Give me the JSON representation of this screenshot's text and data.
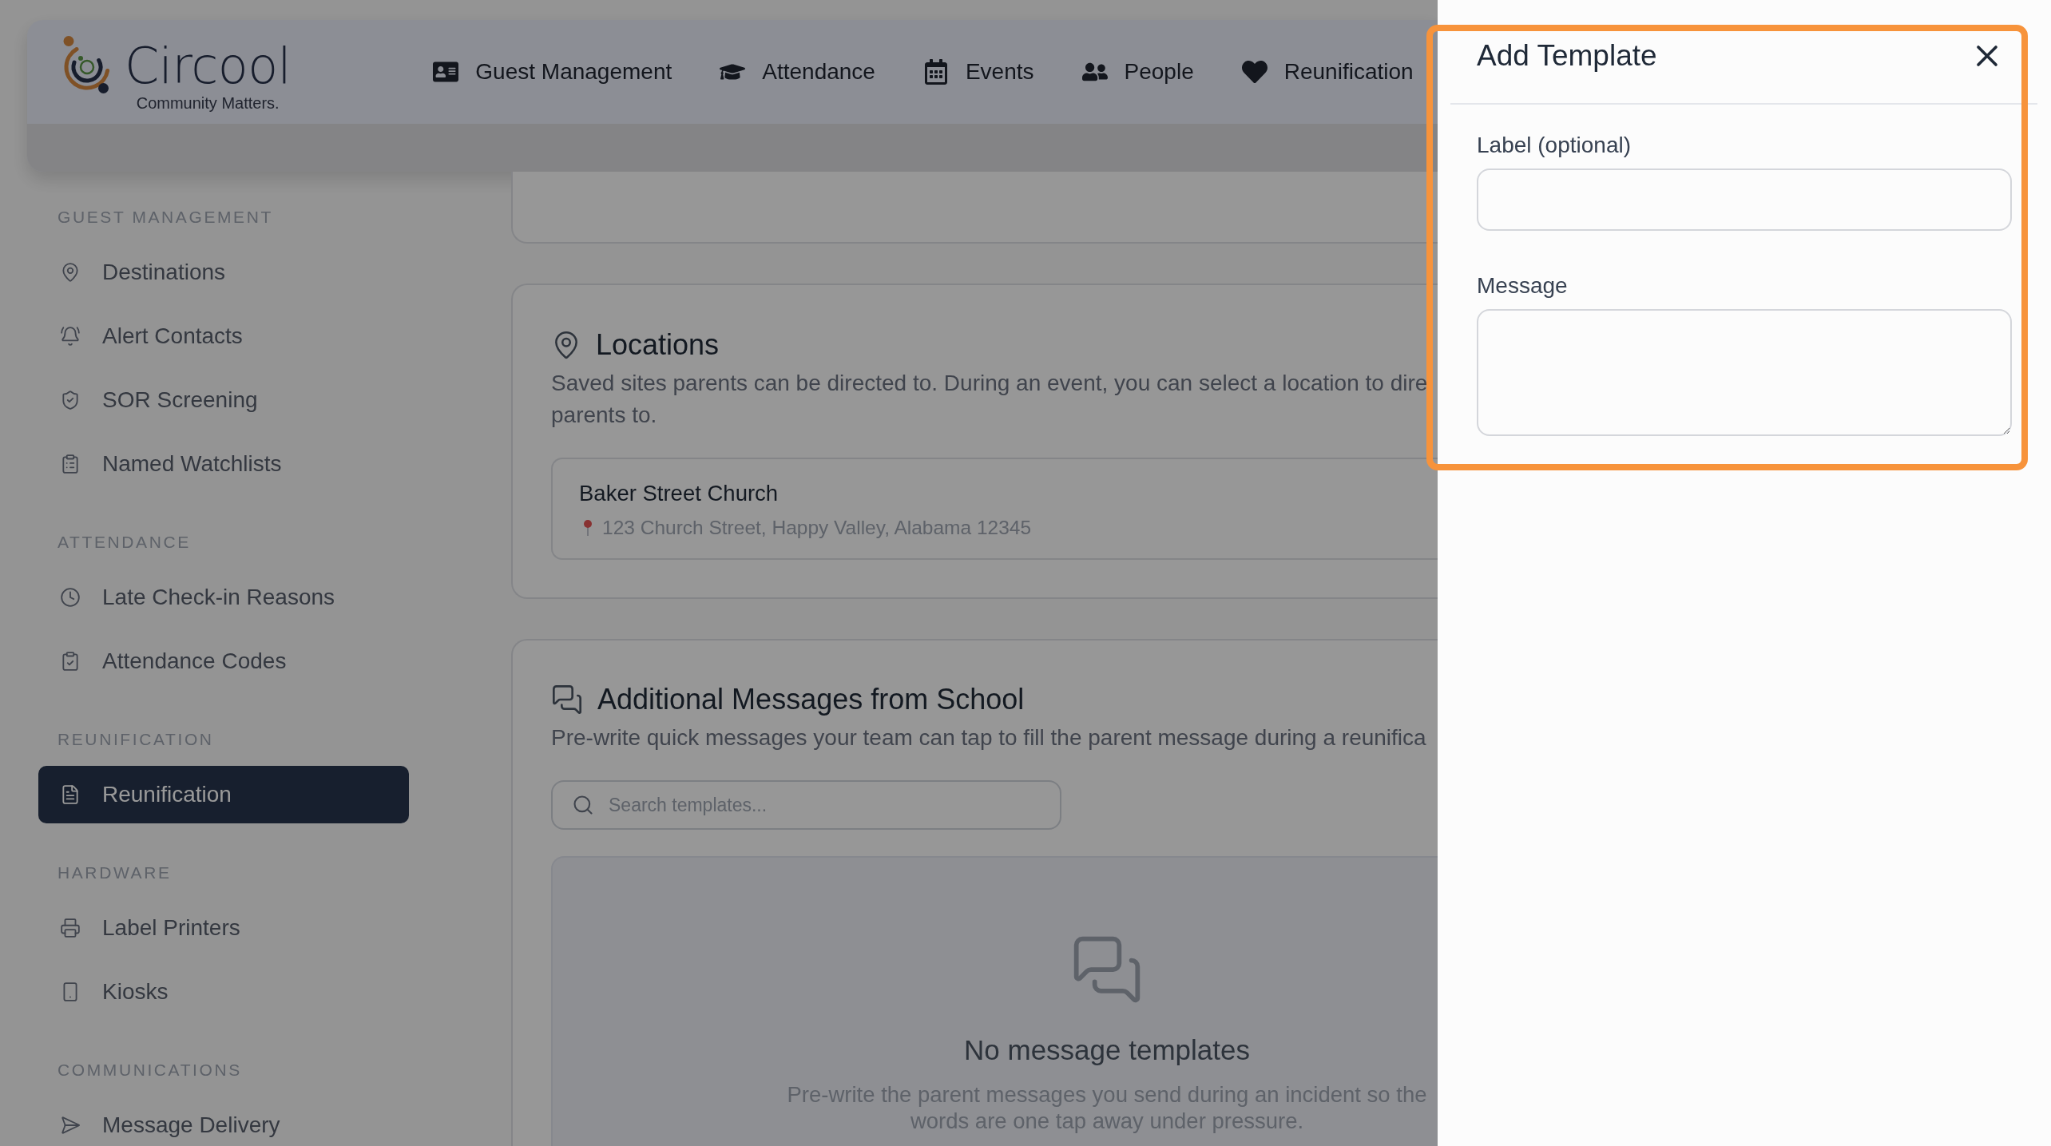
{
  "page_dimmed": true,
  "header": {
    "logo": {
      "name": "Circool",
      "tagline": "Community Matters."
    },
    "nav": [
      {
        "label": "Guest Management"
      },
      {
        "label": "Attendance"
      },
      {
        "label": "Events"
      },
      {
        "label": "People"
      },
      {
        "label": "Reunification"
      }
    ]
  },
  "sidebar": {
    "sections": [
      {
        "title": "GUEST MANAGEMENT",
        "items": [
          {
            "label": "Destinations",
            "selected": false
          },
          {
            "label": "Alert Contacts",
            "selected": false
          },
          {
            "label": "SOR Screening",
            "selected": false
          },
          {
            "label": "Named Watchlists",
            "selected": false
          }
        ]
      },
      {
        "title": "ATTENDANCE",
        "items": [
          {
            "label": "Late Check-in Reasons",
            "selected": false
          },
          {
            "label": "Attendance Codes",
            "selected": false
          }
        ]
      },
      {
        "title": "REUNIFICATION",
        "items": [
          {
            "label": "Reunification",
            "selected": true
          }
        ]
      },
      {
        "title": "HARDWARE",
        "items": [
          {
            "label": "Label Printers",
            "selected": false
          },
          {
            "label": "Kiosks",
            "selected": false
          }
        ]
      },
      {
        "title": "COMMUNICATIONS",
        "items": [
          {
            "label": "Message Delivery",
            "selected": false
          }
        ]
      }
    ]
  },
  "locations": {
    "title": "Locations",
    "description": "Saved sites parents can be directed to. During an event, you can select a location to dire\nparents to.",
    "items": [
      {
        "name": "Baker Street Church",
        "address": "123 Church Street, Happy Valley, Alabama 12345"
      }
    ]
  },
  "messages": {
    "title": "Additional Messages from School",
    "description": "Pre-write quick messages your team can tap to fill the parent message during a reunifica",
    "search": {
      "placeholder": "Search templates..."
    },
    "empty": {
      "title": "No message templates",
      "description": "Pre-write the parent messages you send during an incident so the\nwords are one tap away under pressure."
    }
  },
  "drawer": {
    "title": "Add Template",
    "highlighted": true,
    "fields": [
      {
        "label": "Label (optional)",
        "kind": "input"
      },
      {
        "label": "Message",
        "kind": "textarea"
      }
    ]
  }
}
